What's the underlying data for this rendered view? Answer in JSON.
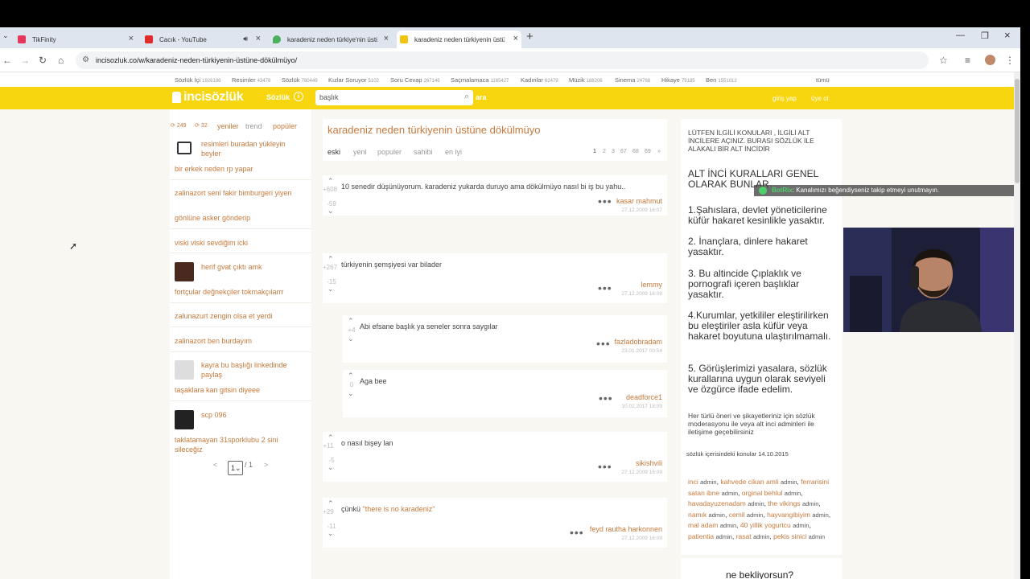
{
  "browser": {
    "tabs": [
      {
        "title": "TikFinity",
        "color": "#e5365c"
      },
      {
        "title": "Cacık - YouTube",
        "color": "#e02b2b"
      },
      {
        "title": "karadeniz neden türkiye'nin üstü",
        "color": "#4ab05c"
      },
      {
        "title": "karadeniz neden türkiyenin üstü",
        "color": "#f2c40f"
      }
    ],
    "url": "incisozluk.co/w/karadeniz-neden-türkiyenin-üstüne-dökülmüyo/"
  },
  "categories": [
    {
      "label": "Sözlük İçi",
      "count": "1926196"
    },
    {
      "label": "Resimler",
      "count": "43478"
    },
    {
      "label": "Sözlük",
      "count": "780449"
    },
    {
      "label": "Kızlar Soruyor",
      "count": "5102"
    },
    {
      "label": "Soru Cevap",
      "count": "267146"
    },
    {
      "label": "Saçmalamaca",
      "count": "1165427"
    },
    {
      "label": "Kadınlar",
      "count": "62479"
    },
    {
      "label": "Müzik",
      "count": "188206"
    },
    {
      "label": "Sinema",
      "count": "24768"
    },
    {
      "label": "Hikaye",
      "count": "79185"
    },
    {
      "label": "Ben",
      "count": "1551012"
    },
    {
      "label": "tümü",
      "count": ""
    }
  ],
  "header": {
    "logo": "incisözlük",
    "sozluk": "Sözlük",
    "search_value": "başlık",
    "search_button": "ara",
    "login": "giriş yap",
    "register": "üye ol"
  },
  "left": {
    "stat1": "249",
    "stat2": "32",
    "tab_new": "yeniler",
    "tab_trend": "trend",
    "tab_popular": "popüler",
    "items": [
      "resimleri buradan yükleyin beyler",
      "bir erkek neden rp yapar",
      "zalinazort seni fakir bimburgeri yiyen",
      "gönlüne asker gönderip",
      "viski viski sevdiğim icki",
      "herif gvat çıktı amk",
      "fortçular değnekçiler tokmakçılarrr",
      "zalunazurt zengin olsa et yerdi",
      "zalinazort ben burdayım",
      "kayra bu başlığı linkedinde paylaş",
      "taşaklara kan gitsin diyeee",
      "scp 096",
      "taklatamayan 31sporklubu 2 sini sileceğiz"
    ],
    "page_current": "1",
    "page_total": "/ 1"
  },
  "topic": {
    "title": "karadeniz neden türkiyenin üstüne dökülmüyo",
    "sorts": [
      "eski",
      "yeni",
      "populer",
      "sahibi",
      "en iyi"
    ],
    "pages": [
      "1",
      "2",
      "3",
      "67",
      "68",
      "69",
      "»"
    ]
  },
  "entries": [
    {
      "up": "+608",
      "down": "-59",
      "text": "10 senedir düşünüyorum. karadeniz yukarda duruyo ama dökülmüyo nasıl bi iş bu yahu..",
      "author": "kasar mahmut",
      "date": "27.12.2009 16:07"
    },
    {
      "up": "+267",
      "down": "-15",
      "text": "türkiyenin şemşiyesi var bilader",
      "author": "lemmy",
      "date": "27.12.2009 16:08"
    },
    {
      "up": "+4",
      "down": "",
      "text": "Abi efsane başlık ya seneler sonra saygılar",
      "author": "fazladobradam",
      "date": "23.01.2017 00:54"
    },
    {
      "up": "0",
      "down": "",
      "text": "Aga bee",
      "author": "deadforce1",
      "date": "10.02.2017 18:09"
    },
    {
      "up": "+11",
      "down": "-5",
      "text": "o nasıl bişey lan",
      "author": "sikishvili",
      "date": "27.12.2009 16:09"
    },
    {
      "up": "+29",
      "down": "-11",
      "text": "çünkü ",
      "quote": "\"there is no karadeniz\"",
      "author": "feyd rautha harkonnen",
      "date": "27.12.2009 16:09"
    }
  ],
  "right": {
    "intro": "LÜTFEN İLGİLİ KONULARI , İLGİLİ ALT İNCİLERE AÇINIZ. BURASI SÖZLÜK İLE ALAKALI BİR ALT İNCİDİR",
    "rules_title": "ALT İNCİ KURALLARI GENEL OLARAK BUNLAR",
    "rule1": "1.Şahıslara, devlet yöneticilerine küfür hakaret kesinlikle yasaktır.",
    "rule2": "2. İnançlara, dinlere hakaret yasaktır.",
    "rule3": "3. Bu altincide Çıplaklık ve pornografi içeren başlıklar yasaktır.",
    "rule4": "4.Kurumlar, yetkililer eleştirilirken bu eleştiriler asla küfür veya hakaret boyutuna ulaştırılmamalı.",
    "rule5": "5. Görüşlerimizi yasalara, sözlük kurallarına uygun olarak seviyeli ve özgürce ifade edelim.",
    "contact": "Her türlü öneri ve şikayetleriniz için sözlük moderasyonu ile veya alt inci adminleri ile iletişime geçebilirsiniz",
    "date_note": "sözlük içerisindeki konular 14.10.2015",
    "admins": [
      "inci",
      "kahvede cikan amli",
      "ferrarisini satan ibne",
      "orginal behlul",
      "havadayuzenadam",
      "the vikings",
      "namık",
      "cemil",
      "hayvangibiyim",
      "mal adam",
      "40 yillik yogurtcu",
      "patientia",
      "rasat",
      "pekis sinici"
    ],
    "admin_label": "admin",
    "box2_title": "ne bekliyorsun?"
  },
  "overlay": {
    "chat_user": "BotRix",
    "chat_msg": ": Kanalımızı beğendiyseniz takip etmeyi unutmayın."
  }
}
